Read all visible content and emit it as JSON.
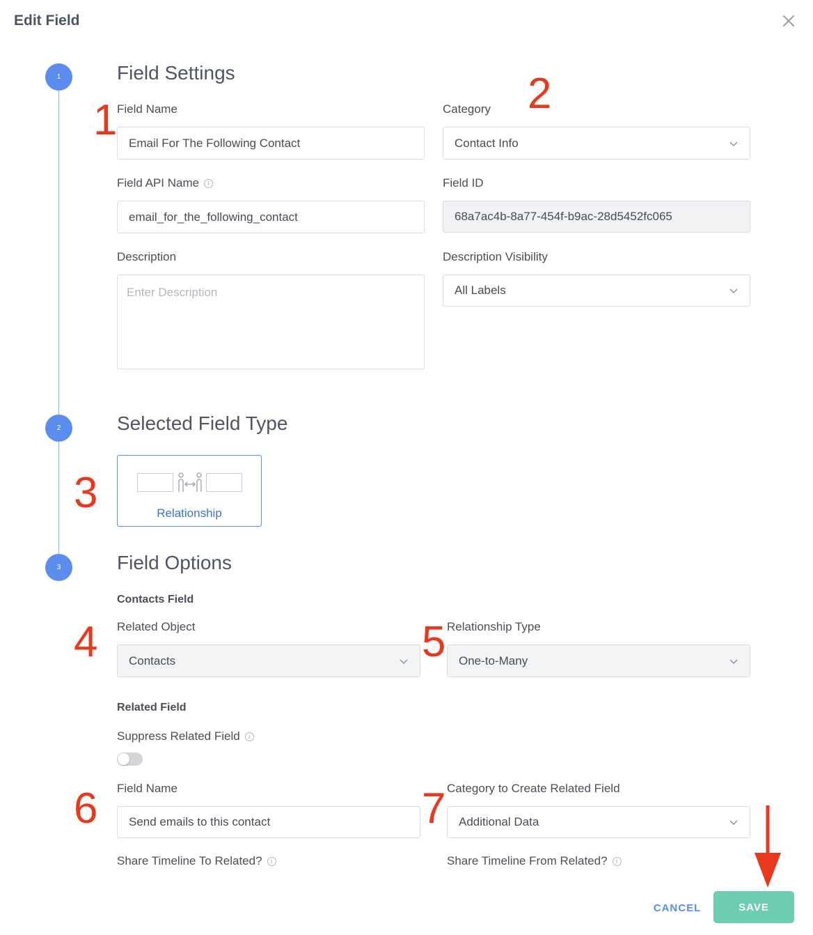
{
  "modal": {
    "title": "Edit Field"
  },
  "steps": [
    "1",
    "2",
    "3"
  ],
  "field_settings": {
    "title": "Field Settings",
    "field_name": {
      "label": "Field Name",
      "value": "Email For The Following Contact"
    },
    "category": {
      "label": "Category",
      "value": "Contact Info"
    },
    "api_name": {
      "label": "Field API Name",
      "value": "email_for_the_following_contact"
    },
    "field_id": {
      "label": "Field ID",
      "value": "68a7ac4b-8a77-454f-b9ac-28d5452fc065"
    },
    "description": {
      "label": "Description",
      "placeholder": "Enter Description"
    },
    "description_visibility": {
      "label": "Description Visibility",
      "value": "All Labels"
    }
  },
  "field_type": {
    "title": "Selected Field Type",
    "card_label": "Relationship"
  },
  "field_options": {
    "title": "Field Options",
    "contacts_field_heading": "Contacts Field",
    "related_object": {
      "label": "Related Object",
      "value": "Contacts"
    },
    "relationship_type": {
      "label": "Relationship Type",
      "value": "One-to-Many"
    },
    "related_field_heading": "Related Field",
    "suppress": {
      "label": "Suppress Related Field",
      "enabled": false
    },
    "related_field_name": {
      "label": "Field Name",
      "value": "Send emails to this contact"
    },
    "related_category": {
      "label": "Category to Create Related Field",
      "value": "Additional Data"
    },
    "share_to": {
      "label": "Share Timeline To Related?"
    },
    "share_from": {
      "label": "Share Timeline From Related?"
    }
  },
  "annotations": [
    "1",
    "2",
    "3",
    "4",
    "5",
    "6",
    "7"
  ],
  "footer": {
    "cancel_label": "CANCEL",
    "save_label": "SAVE"
  },
  "colors": {
    "accent": "#5b8def",
    "save_button": "#6ccdb3",
    "annotation": "#e8391f"
  },
  "icons": [
    "close-icon",
    "chevron-down-icon",
    "info-icon",
    "relationship-icon",
    "arrow-down-icon"
  ]
}
